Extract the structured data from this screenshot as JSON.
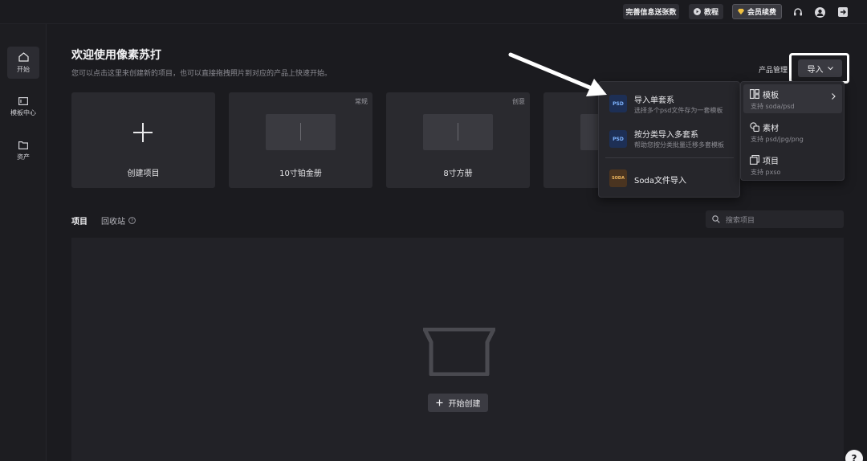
{
  "topbar": {
    "complete_info_label": "完善信息送张数",
    "tutorial_label": "教程",
    "renew_label": "会员续费"
  },
  "sidebar": {
    "items": [
      {
        "label": "开始",
        "icon": "home-icon"
      },
      {
        "label": "模板中心",
        "icon": "template-icon"
      },
      {
        "label": "资产",
        "icon": "folder-icon"
      }
    ]
  },
  "header": {
    "title": "欢迎使用像素苏打",
    "subtitle": "您可以点击这里来创建新的项目，也可以直接拖拽照片到对应的产品上快速开始。",
    "product_manage": "产品管理",
    "import_label": "导入"
  },
  "cards": [
    {
      "label": "创建项目",
      "tag": ""
    },
    {
      "label": "10寸铂金册",
      "tag": "常规"
    },
    {
      "label": "8寸方册",
      "tag": "创意"
    }
  ],
  "tabs": {
    "projects": "项目",
    "recycle": "回收站"
  },
  "search": {
    "placeholder": "搜索项目"
  },
  "empty": {
    "start_label": "开始创建"
  },
  "import_menu": {
    "left": [
      {
        "title": "导入单套系",
        "desc": "选择多个psd文件存为一套模板",
        "icon": "PSD"
      },
      {
        "title": "按分类导入多套系",
        "desc": "帮助您按分类批量迁移多套模板",
        "icon": "PSD"
      },
      {
        "title": "Soda文件导入",
        "desc": "",
        "icon": "SODA"
      }
    ],
    "right": [
      {
        "title": "模板",
        "desc": "支持 soda/psd"
      },
      {
        "title": "素材",
        "desc": "支持 psd/jpg/png"
      },
      {
        "title": "项目",
        "desc": "支持 pxso"
      }
    ]
  },
  "help": "?",
  "colors": {
    "background": "#1b1b1f",
    "card": "#2a2a2f",
    "menu": "#26262b",
    "accent_psd": "#1d2f55"
  }
}
